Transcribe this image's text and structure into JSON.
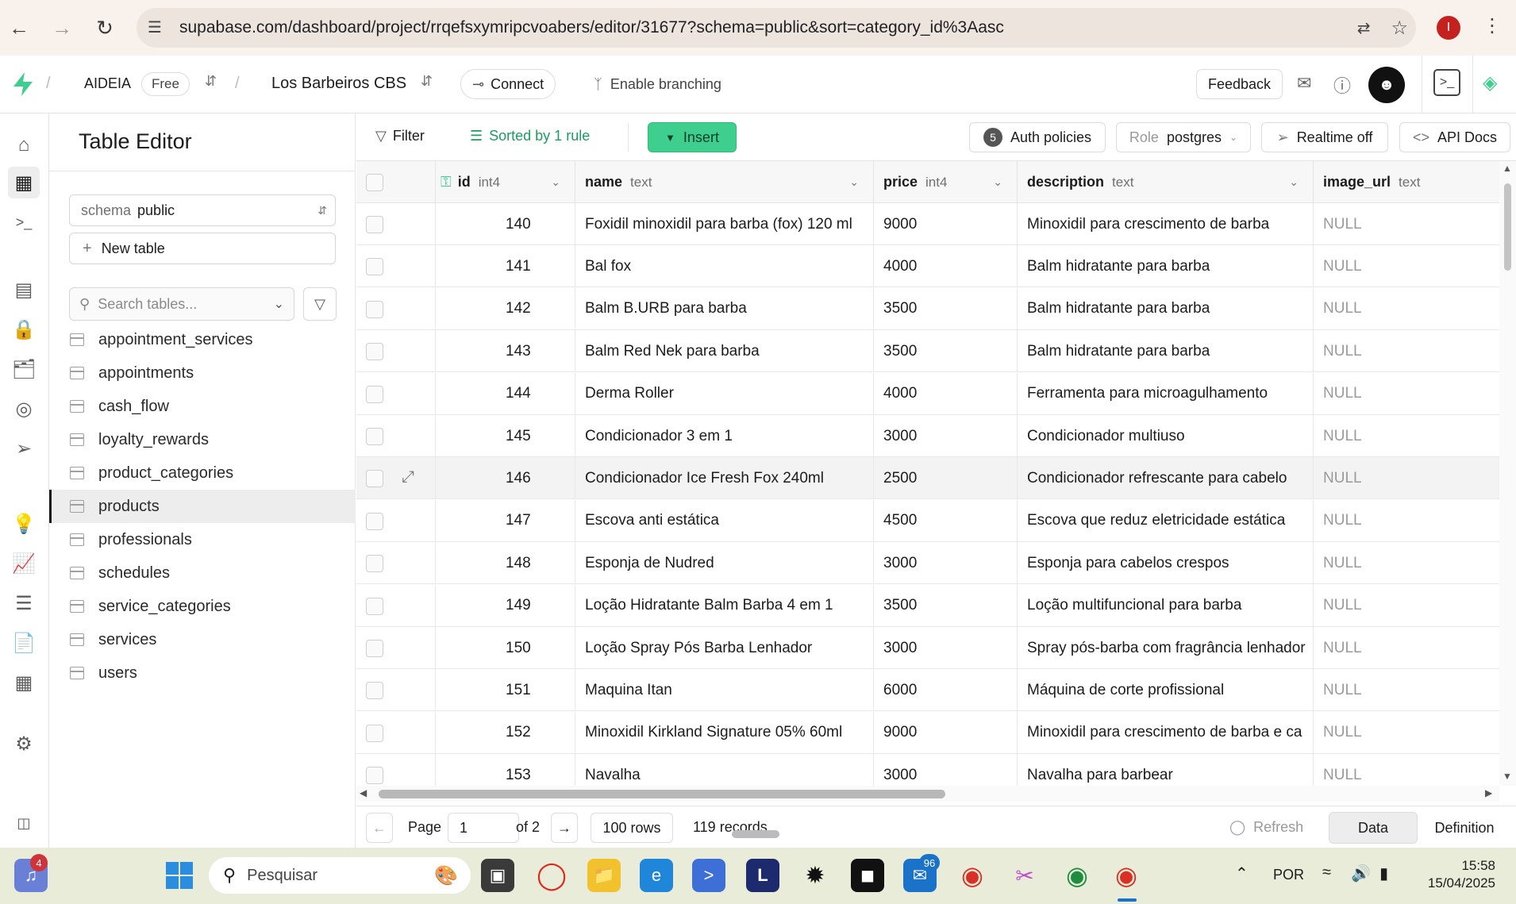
{
  "browser": {
    "url": "supabase.com/dashboard/project/rrqefsxymripcvoabers/editor/31677?schema=public&sort=category_id%3Aasc",
    "profile_initial": "I"
  },
  "header": {
    "org": "AIDEIA",
    "plan": "Free",
    "project": "Los Barbeiros CBS",
    "connect": "Connect",
    "branching": "Enable branching",
    "feedback": "Feedback"
  },
  "sidebar": {
    "title": "Table Editor",
    "schema_label": "schema",
    "schema_value": "public",
    "new_table": "New table",
    "search_placeholder": "Search tables...",
    "tables": [
      "appointment_services",
      "appointments",
      "cash_flow",
      "loyalty_rewards",
      "product_categories",
      "products",
      "professionals",
      "schedules",
      "service_categories",
      "services",
      "users"
    ],
    "active_table": "products"
  },
  "toolbar": {
    "filter": "Filter",
    "sorted": "Sorted by 1 rule",
    "insert": "Insert",
    "auth_count": "5",
    "auth_policies": "Auth policies",
    "role_label": "Role",
    "role_value": "postgres",
    "realtime": "Realtime off",
    "api_docs": "API Docs"
  },
  "grid": {
    "columns": [
      {
        "name": "id",
        "type": "int4"
      },
      {
        "name": "name",
        "type": "text"
      },
      {
        "name": "price",
        "type": "int4"
      },
      {
        "name": "description",
        "type": "text"
      },
      {
        "name": "image_url",
        "type": "text"
      }
    ],
    "rows": [
      [
        "140",
        "Foxidil minoxidil para barba (fox) 120 ml",
        "9000",
        "Minoxidil para crescimento de barba",
        "NULL"
      ],
      [
        "141",
        "Bal fox",
        "4000",
        "Balm hidratante para barba",
        "NULL"
      ],
      [
        "142",
        "Balm B.URB para barba",
        "3500",
        "Balm hidratante para barba",
        "NULL"
      ],
      [
        "143",
        "Balm Red Nek para barba",
        "3500",
        "Balm hidratante para barba",
        "NULL"
      ],
      [
        "144",
        "Derma Roller",
        "4000",
        "Ferramenta para microagulhamento",
        "NULL"
      ],
      [
        "145",
        "Condicionador 3 em 1",
        "3000",
        "Condicionador multiuso",
        "NULL"
      ],
      [
        "146",
        "Condicionador Ice Fresh Fox 240ml",
        "2500",
        "Condicionador refrescante para cabelo",
        "NULL"
      ],
      [
        "147",
        "Escova anti estática",
        "4500",
        "Escova que reduz eletricidade estática",
        "NULL"
      ],
      [
        "148",
        "Esponja de Nudred",
        "3000",
        "Esponja para cabelos crespos",
        "NULL"
      ],
      [
        "149",
        "Loção Hidratante Balm Barba 4 em 1",
        "3500",
        "Loção multifuncional para barba",
        "NULL"
      ],
      [
        "150",
        "Loção Spray Pós Barba Lenhador",
        "3000",
        "Spray pós-barba com fragrância lenhador",
        "NULL"
      ],
      [
        "151",
        "Maquina Itan",
        "6000",
        "Máquina de corte profissional",
        "NULL"
      ],
      [
        "152",
        "Minoxidil Kirkland Signature 05% 60ml",
        "9000",
        "Minoxidil para crescimento de barba e ca",
        "NULL"
      ],
      [
        "153",
        "Navalha",
        "3000",
        "Navalha para barbear",
        "NULL"
      ]
    ]
  },
  "footer": {
    "page_label": "Page",
    "page_value": "1",
    "of": "of 2",
    "rows": "100 rows",
    "records": "119 records",
    "refresh": "Refresh",
    "data_tab": "Data",
    "definition_tab": "Definition"
  },
  "taskbar": {
    "search_placeholder": "Pesquisar",
    "lang": "POR",
    "time": "15:58",
    "date": "15/04/2025",
    "badge_left": "4",
    "badge_mail": "96"
  },
  "colors": {
    "accent": "#3ecf8e",
    "browser_bar": "#f8f1ec",
    "taskbar": "#e8ecd8"
  }
}
